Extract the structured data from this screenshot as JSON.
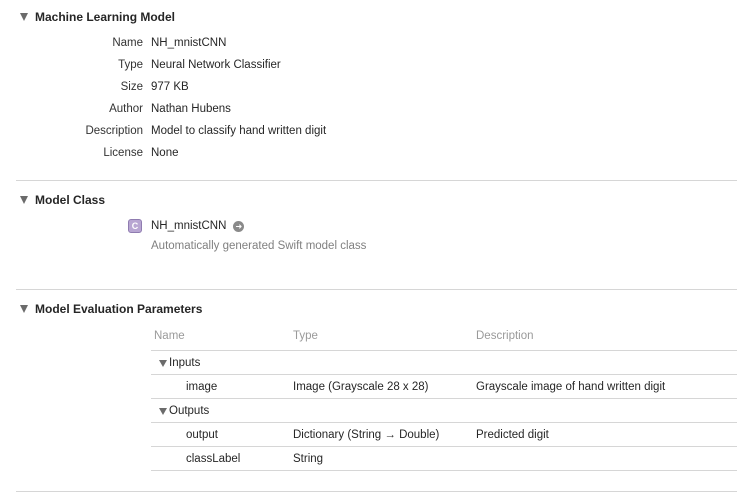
{
  "model_section": {
    "title": "Machine Learning Model",
    "fields": [
      {
        "label": "Name",
        "value": "NH_mnistCNN"
      },
      {
        "label": "Type",
        "value": "Neural Network Classifier"
      },
      {
        "label": "Size",
        "value": "977 KB"
      },
      {
        "label": "Author",
        "value": "Nathan Hubens"
      },
      {
        "label": "Description",
        "value": "Model to classify hand written digit"
      },
      {
        "label": "License",
        "value": "None"
      }
    ]
  },
  "class_section": {
    "title": "Model Class",
    "badge": "C",
    "class_name": "NH_mnistCNN",
    "goto_icon": "arrow-right-circle-icon",
    "description": "Automatically generated Swift model class"
  },
  "eval_section": {
    "title": "Model Evaluation Parameters",
    "columns": [
      "Name",
      "Type",
      "Description"
    ],
    "groups": [
      {
        "label": "Inputs",
        "rows": [
          {
            "name": "image",
            "type": "Image (Grayscale 28 x 28)",
            "description": "Grayscale image of hand written digit"
          }
        ]
      },
      {
        "label": "Outputs",
        "rows": [
          {
            "name": "output",
            "type": "Dictionary (String → Double)",
            "description": "Predicted digit"
          },
          {
            "name": "classLabel",
            "type": "String",
            "description": ""
          }
        ]
      }
    ]
  }
}
